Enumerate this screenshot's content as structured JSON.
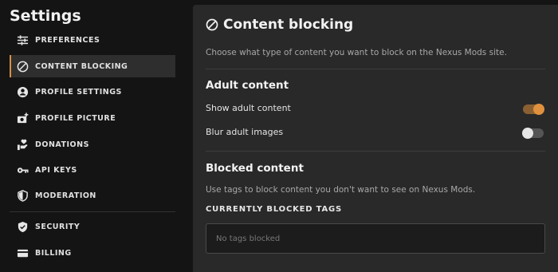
{
  "sidebar": {
    "title": "Settings",
    "items": [
      {
        "label": "PREFERENCES",
        "icon": "sliders-icon"
      },
      {
        "label": "CONTENT BLOCKING",
        "icon": "block-icon",
        "active": true
      },
      {
        "label": "PROFILE SETTINGS",
        "icon": "user-circle-icon"
      },
      {
        "label": "PROFILE PICTURE",
        "icon": "add-photo-icon"
      },
      {
        "label": "DONATIONS",
        "icon": "donation-hand-icon"
      },
      {
        "label": "API KEYS",
        "icon": "key-icon"
      },
      {
        "label": "MODERATION",
        "icon": "shield-half-icon"
      },
      {
        "label": "SECURITY",
        "icon": "shield-check-icon"
      },
      {
        "label": "BILLING",
        "icon": "credit-card-icon"
      }
    ]
  },
  "main": {
    "title": "Content blocking",
    "description": "Choose what type of content you want to block on the Nexus Mods site.",
    "adult": {
      "heading": "Adult content",
      "show_label": "Show adult content",
      "show_on": true,
      "blur_label": "Blur adult images",
      "blur_on": false
    },
    "blocked": {
      "heading": "Blocked content",
      "description": "Use tags to block content you don't want to see on Nexus Mods.",
      "tags_label": "CURRENTLY BLOCKED TAGS",
      "placeholder": "No tags blocked"
    }
  },
  "colors": {
    "accent": "#e0913e",
    "background": "#141414",
    "panel": "#292929"
  }
}
